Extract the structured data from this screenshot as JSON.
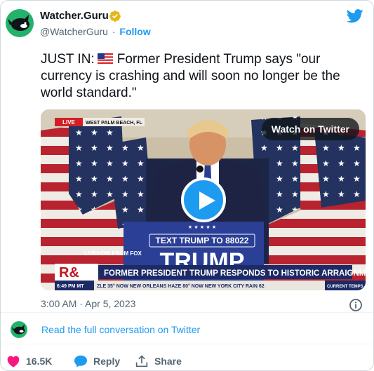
{
  "author": {
    "name": "Watcher.Guru",
    "handle": "@WatcherGuru",
    "separator": "·",
    "follow_label": "Follow"
  },
  "tweet": {
    "prefix": "JUST IN:",
    "body": "Former President Trump says \"our currency is crashing and will soon no longer be the world standard.\"",
    "timestamp": "3:00 AM · Apr 5, 2023"
  },
  "media": {
    "watch_label": "Watch on Twitter",
    "live_badge": "LIVE",
    "location": "WEST PALM BEACH, FL",
    "podium_sign": "TEXT TRUMP TO 88022",
    "podium_banner": "TRUMP",
    "livenow": "LIVENOW FROM FOX",
    "network_logo": "R&",
    "headline": "FORMER PRESIDENT TRUMP RESPONDS TO HISTORIC ARRAIGNMENT",
    "ticker_time": "6:49 PM MT",
    "ticker": "ZLE 35°  NOW  NEW ORLEANS  HAZE 80°  NOW  NEW YORK CITY  RAIN 62",
    "ticker_tag": "CURRENT TEMPS"
  },
  "conversation": {
    "link_label": "Read the full conversation on Twitter"
  },
  "actions": {
    "likes": "16.5K",
    "reply_label": "Reply",
    "share_label": "Share"
  },
  "colors": {
    "accent": "#1d9bf0",
    "like": "#f91880",
    "brand_green": "#23b26b",
    "verified_gold": "#e2b719"
  },
  "icons": [
    "watcher-guru-avatar",
    "verified-badge-icon",
    "twitter-bird-icon",
    "us-flag-icon",
    "play-icon",
    "info-icon",
    "heart-icon",
    "reply-bubble-icon",
    "share-icon"
  ]
}
